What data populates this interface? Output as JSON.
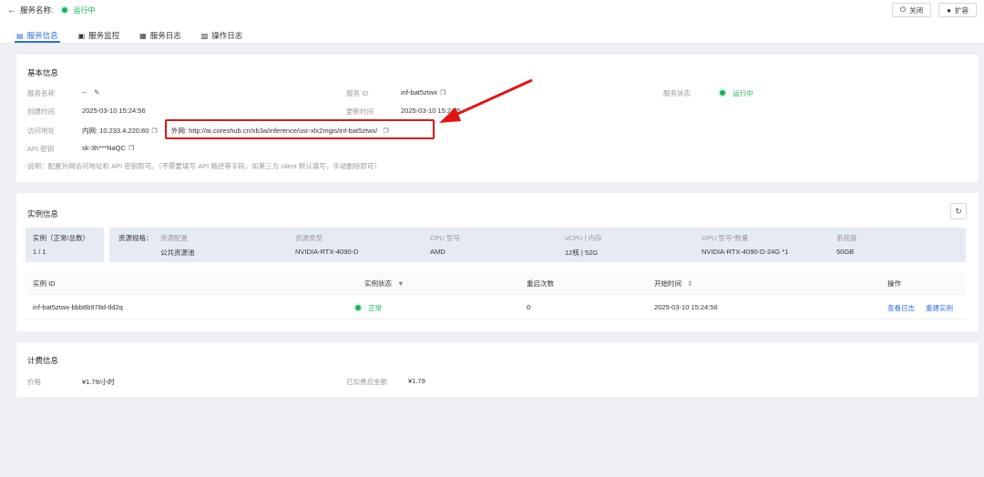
{
  "header": {
    "back_label": "服务名称:",
    "status": "运行中",
    "close_label": "关闭",
    "scale_label": "扩容"
  },
  "tabs": [
    {
      "label": "服务信息",
      "active": true,
      "icon": "doc-icon"
    },
    {
      "label": "服务监控",
      "active": false,
      "icon": "monitor-icon"
    },
    {
      "label": "服务日志",
      "active": false,
      "icon": "log-icon"
    },
    {
      "label": "操作日志",
      "active": false,
      "icon": "edit-log-icon"
    }
  ],
  "basic": {
    "title": "基本信息",
    "service_name_label": "服务名称",
    "service_name_value": "--",
    "service_id_label": "服务 ID",
    "service_id_value": "inf-bat5ztwx",
    "service_status_label": "服务状态",
    "service_status_value": "运行中",
    "created_label": "创建时间",
    "created_value": "2025-03-10 15:24:56",
    "updated_label": "更新时间",
    "updated_value": "2025-03-10 15:24:5",
    "access_label": "访问地址",
    "internal_value": "内网: 10.233.4.220:80",
    "external_value": "外网: http://ai.coreshub.cn/xb3a/inference/usr-xlx2mgis/inf-bat5ztwx/",
    "api_key_label": "API 密钥",
    "api_key_value": "sk-3h***NaQC",
    "note": "说明：配置外网访问地址和 API 密钥即可。（不需要填写 API 路径等字段，如第三方 client 默认填写，手动删除即可）"
  },
  "instances": {
    "title": "实例信息",
    "count_label": "实例（正常/总数）",
    "count_value": "1 / 1",
    "spec_label": "资源规格：",
    "resource_config_label": "资源配置",
    "resource_config_value": "公共资源池",
    "resource_type_label": "资源类型",
    "resource_type_value": "NVIDIA-RTX-4090-D",
    "cpu_label": "CPU 型号",
    "cpu_value": "AMD",
    "vcpu_label": "vCPU | 内存",
    "vcpu_value": "12核 | 52G",
    "gpu_label": "GPU 型号*数量",
    "gpu_value": "NVIDIA-RTX-4090-D-24G *1",
    "disk_label": "系统盘",
    "disk_value": "50GB",
    "columns": [
      "实例 ID",
      "实例状态",
      "重启次数",
      "开始时间",
      "操作"
    ],
    "rows": [
      {
        "id": "inf-bat5ztwx-bbb8b978d-tld2q",
        "status": "正常",
        "restarts": "0",
        "start": "2025-03-10 15:24:56",
        "action_logs": "查看日志",
        "action_rebuild": "重建实例"
      }
    ]
  },
  "billing": {
    "title": "计费信息",
    "price_label": "价格",
    "price_value": "¥1.79/小时",
    "deducted_label": "已扣费总金额",
    "deducted_value": "¥1.79"
  },
  "colors": {
    "accent": "#2f6ee8",
    "success": "#19b35b",
    "annotation": "#e01515"
  }
}
